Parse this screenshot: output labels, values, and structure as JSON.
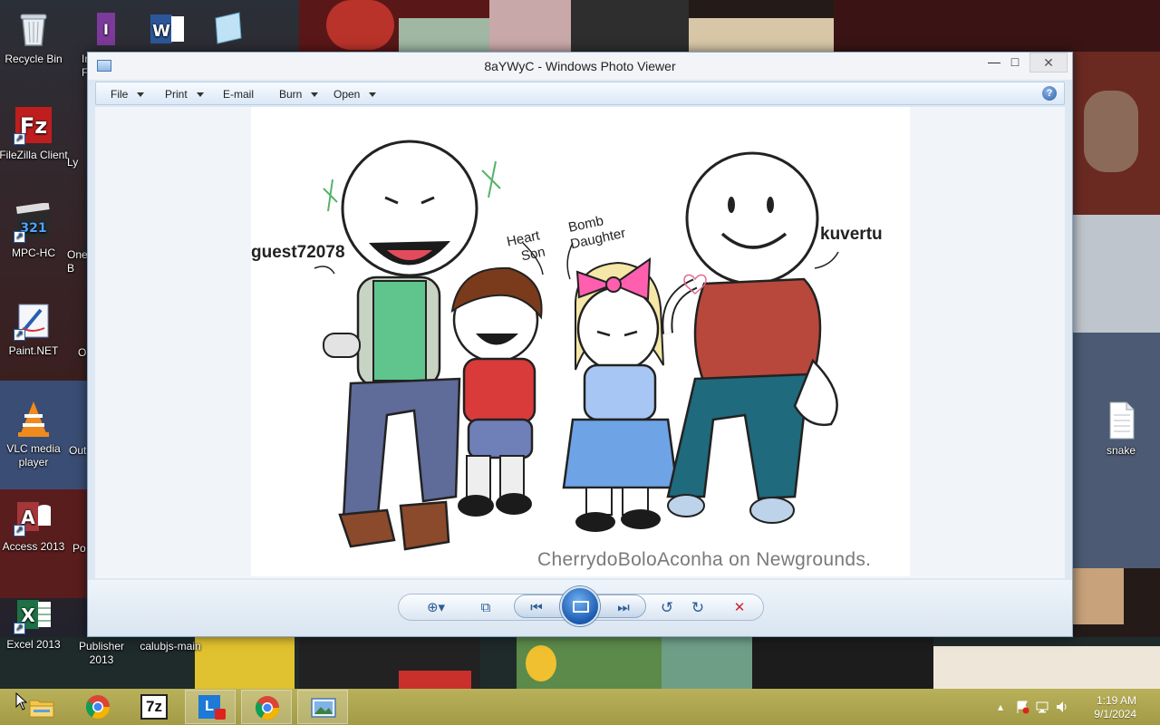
{
  "desktop": {
    "icons": [
      {
        "label": "Recycle Bin"
      },
      {
        "label": "FileZilla Client"
      },
      {
        "label": "MPC-HC"
      },
      {
        "label": "Paint.NET"
      },
      {
        "label": "VLC media player"
      },
      {
        "label": "Access 2013"
      },
      {
        "label": "Excel 2013"
      },
      {
        "label": "Publisher 2013"
      },
      {
        "label": "calubjs-main"
      },
      {
        "label": "snake"
      }
    ],
    "partial_labels": {
      "in": "In",
      "fi": "Fi",
      "ly": "Ly",
      "on": "One",
      "b": "B",
      "o": "O",
      "out": "Out",
      "po": "Po"
    }
  },
  "window": {
    "title": "8aYWyC - Windows Photo Viewer",
    "min_symbol": "—",
    "max_symbol": "□",
    "close_symbol": "✕",
    "menu": [
      {
        "label": "File",
        "has_caret": true
      },
      {
        "label": "Print",
        "has_caret": true
      },
      {
        "label": "E-mail",
        "has_caret": false
      },
      {
        "label": "Burn",
        "has_caret": true
      },
      {
        "label": "Open",
        "has_caret": true
      }
    ],
    "help_symbol": "?"
  },
  "image": {
    "labels": {
      "guest": "guest72078",
      "kuvertu": "kuvertu",
      "heart_son_1": "Heart",
      "heart_son_2": "Son",
      "bomb_daughter_1": "Bomb",
      "bomb_daughter_2": "Daughter"
    },
    "credit": "CherrydoBoloAconha on Newgrounds."
  },
  "controls": {
    "zoom_symbol": "⊕▾",
    "actual_size_symbol": "⧉",
    "prev_symbol": "⏮",
    "next_symbol": "⏭",
    "rotate_ccw_symbol": "↺",
    "rotate_cw_symbol": "↻",
    "delete_symbol": "✕"
  },
  "taskbar": {
    "apps": [
      {
        "name": "File Explorer"
      },
      {
        "name": "Chrome"
      },
      {
        "name": "7-Zip"
      },
      {
        "name": "Lync"
      },
      {
        "name": "Chrome"
      },
      {
        "name": "Windows Photo Viewer"
      }
    ],
    "sevenzip_label": "7z",
    "lync_label": "L",
    "tray": {
      "show_hidden_symbol": "▴",
      "time": "1:19 AM",
      "date": "9/1/2024"
    }
  },
  "colors": {
    "titlebar": "#f2f4f7",
    "window_frame": "#dde8f3",
    "taskbar": "#a29a45",
    "accent_blue": "#1c5ab0"
  }
}
